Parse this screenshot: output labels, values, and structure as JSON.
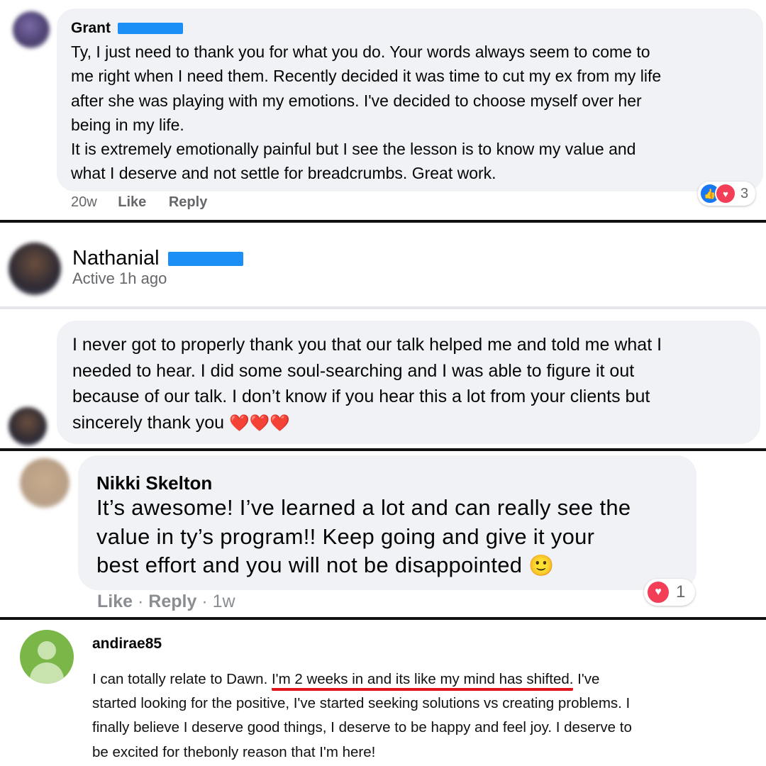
{
  "comment1": {
    "author_first": "Grant",
    "text": "Ty, I just need to thank you for what you do. Your words always seem to come to\nme right when I need them. Recently decided it was time to cut my ex from my life\nafter she was playing with my emotions. I've decided to choose myself over her\nbeing in my life.\nIt is extremely emotionally painful but I see the lesson is to know my value and\nwhat I deserve and not settle for breadcrumbs. Great work.",
    "time": "20w",
    "like_label": "Like",
    "reply_label": "Reply",
    "reaction_count": "3",
    "reaction_icons": [
      "like-icon",
      "love-icon"
    ],
    "colors": {
      "like": "#1877f2",
      "love": "#f33e58"
    }
  },
  "message2": {
    "author_first": "Nathanial",
    "status": "Active 1h ago",
    "text": "I never got to properly thank you that our talk helped me and told me what I\nneeded to hear. I did some soul-searching and I was able to figure it out\nbecause of our talk. I don’t know if you hear this a lot from your clients but\nsincerely thank you",
    "emoji": "❤️❤️❤️"
  },
  "comment3": {
    "author": "Nikki Skelton",
    "text": "It’s awesome! I’ve learned a lot and can really see the\nvalue in ty’s program!! Keep going and give it your\nbest effort and you will not be disappointed",
    "emoji": "🙂",
    "like_label": "Like",
    "reply_label": "Reply",
    "time": "1w",
    "sep": "·",
    "reaction_count": "1",
    "reaction_icons": [
      "love-icon"
    ]
  },
  "review4": {
    "author": "andirae85",
    "text_before": "I can totally relate to Dawn. ",
    "text_underlined": "I'm 2 weeks in and its like my mind has shifted.",
    "text_after": " I've\nstarted looking for the positive, I've started seeking solutions vs creating problems. I\nfinally believe I deserve good things, I deserve to be happy and feel joy. I deserve to\nbe excited for thebonly reason that I'm here!",
    "avatar_color": "#7ab648",
    "underline_color": "#e0141c"
  }
}
